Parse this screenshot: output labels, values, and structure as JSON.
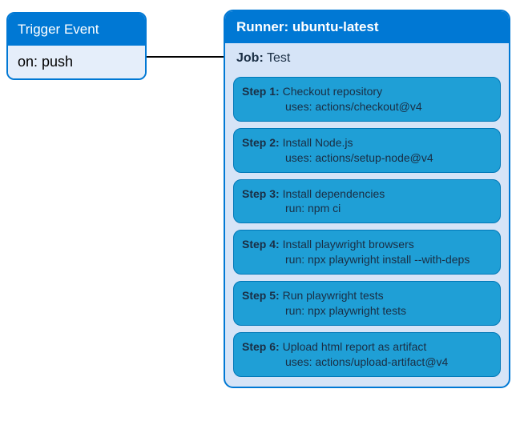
{
  "trigger": {
    "title": "Trigger Event",
    "body": "on: push"
  },
  "runner": {
    "title": "Runner: ubuntu-latest",
    "job_label": "Job:",
    "job_name": "Test",
    "steps": [
      {
        "num": "Step 1:",
        "line1": " Checkout repository",
        "line2": " uses: actions/checkout@v4"
      },
      {
        "num": "Step 2:",
        "line1": "Install Node.js",
        "line2": "uses: actions/setup-node@v4"
      },
      {
        "num": "Step 3:",
        "line1": "Install dependencies",
        "line2": "run: npm ci"
      },
      {
        "num": "Step 4:",
        "line1": "Install playwright browsers",
        "line2": "run: npx playwright install --with-deps"
      },
      {
        "num": "Step 5:",
        "line1": "Run playwright tests",
        "line2": "run: npx playwright tests"
      },
      {
        "num": "Step 6:",
        "line1": "Upload html report as artifact",
        "line2": "uses: actions/upload-artifact@v4"
      }
    ]
  }
}
